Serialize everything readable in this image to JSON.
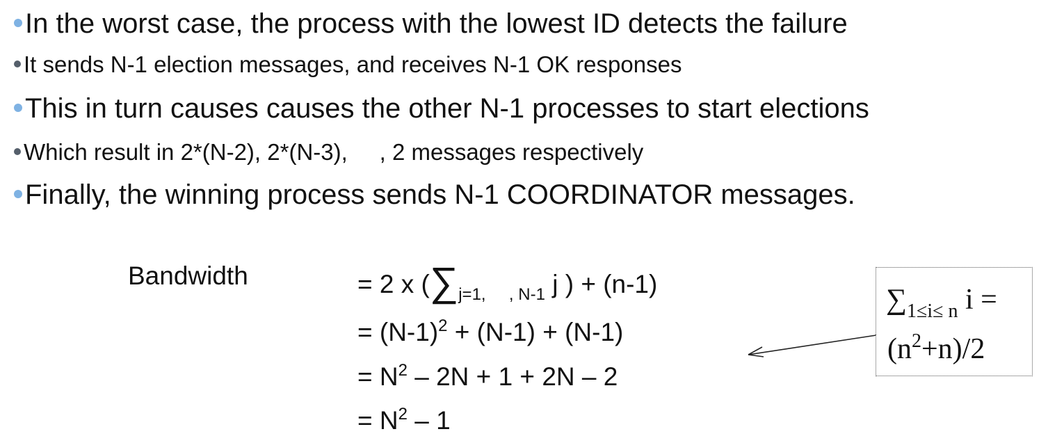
{
  "colors": {
    "bullet_large": "#7fb2e3",
    "bullet_small": "#555f6b",
    "text": "#111111"
  },
  "bullets": [
    {
      "text": "In the worst case, the process with the lowest ID detects the failure"
    },
    {
      "text": "It sends N-1 election messages, and receives N-1 OK responses"
    },
    {
      "text": "This in turn causes causes the other N-1 processes to start elections"
    },
    {
      "text": "Which result in 2*(N-2), 2*(N-3),     , 2 messages respectively"
    },
    {
      "text": "Finally, the winning process sends N-1 COORDINATOR messages."
    }
  ],
  "math": {
    "label": "Bandwidth",
    "line1": {
      "pre": "= 2 x (",
      "sigma": "∑",
      "sub": "j=1,     , N-1",
      "post": " j ) + (n-1)"
    },
    "line2": {
      "pre": "= (N-1)",
      "sup": "2",
      "post": " + (N-1) + (N-1)"
    },
    "line3": {
      "pre": "= N",
      "sup": "2",
      "post": " – 2N + 1 + 2N – 2"
    },
    "line4": {
      "pre": "= N",
      "sup": "2",
      "post": " – 1"
    }
  },
  "formula_box": {
    "sigma": "∑",
    "sub": "1≤i≤ n",
    "rhs": " i =",
    "line2_pre": "(n",
    "line2_sup": "2",
    "line2_post": "+n)/2"
  }
}
